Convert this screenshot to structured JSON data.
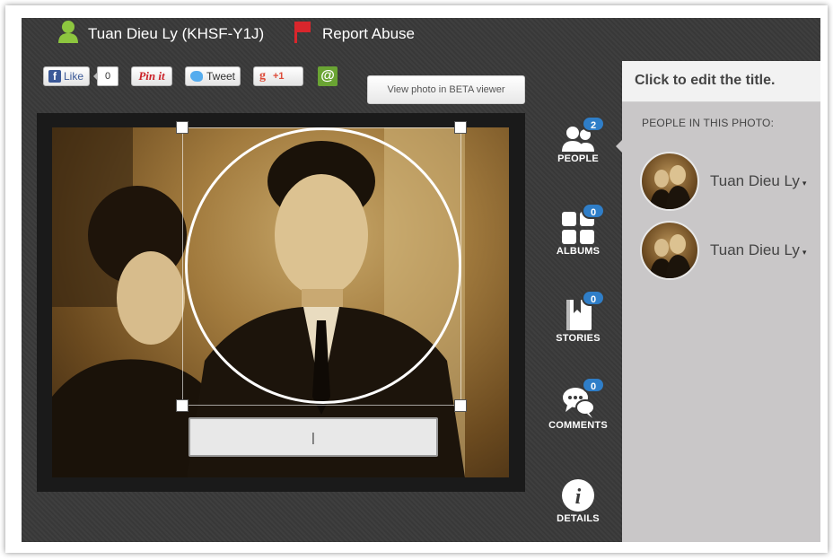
{
  "header": {
    "person_name": "Tuan Dieu Ly (KHSF-Y1J)",
    "report_label": "Report Abuse"
  },
  "share": {
    "like_label": "Like",
    "like_count": "0",
    "pin_label": "Pin it",
    "tweet_label": "Tweet",
    "gplus_label": "+1",
    "email_symbol": "@"
  },
  "viewer": {
    "beta_label": "View photo in BETA viewer",
    "tag_input_value": "|"
  },
  "rail": {
    "people": {
      "label": "PEOPLE",
      "count": "2"
    },
    "albums": {
      "label": "ALBUMS",
      "count": "0"
    },
    "stories": {
      "label": "STORIES",
      "count": "0"
    },
    "comments": {
      "label": "COMMENTS",
      "count": "0"
    },
    "details": {
      "label": "DETAILS",
      "icon_glyph": "i"
    }
  },
  "panel": {
    "title": "Click to edit the title.",
    "subtitle": "PEOPLE IN THIS PHOTO:",
    "people": [
      {
        "name": "Tuan Dieu Ly"
      },
      {
        "name": "Tuan Dieu Ly"
      }
    ],
    "caret": "▾"
  },
  "colors": {
    "background": "#3a3a3a",
    "badge": "#2f7ec8",
    "panel": "#c9c7c8",
    "accent_green": "#8dc63f",
    "flag_red": "#d9262c"
  },
  "icons": {
    "person": "person-icon",
    "flag": "flag-icon",
    "people": "people-icon",
    "albums": "albums-grid-icon",
    "stories": "book-icon",
    "comments": "speech-bubbles-icon",
    "details": "info-icon"
  }
}
